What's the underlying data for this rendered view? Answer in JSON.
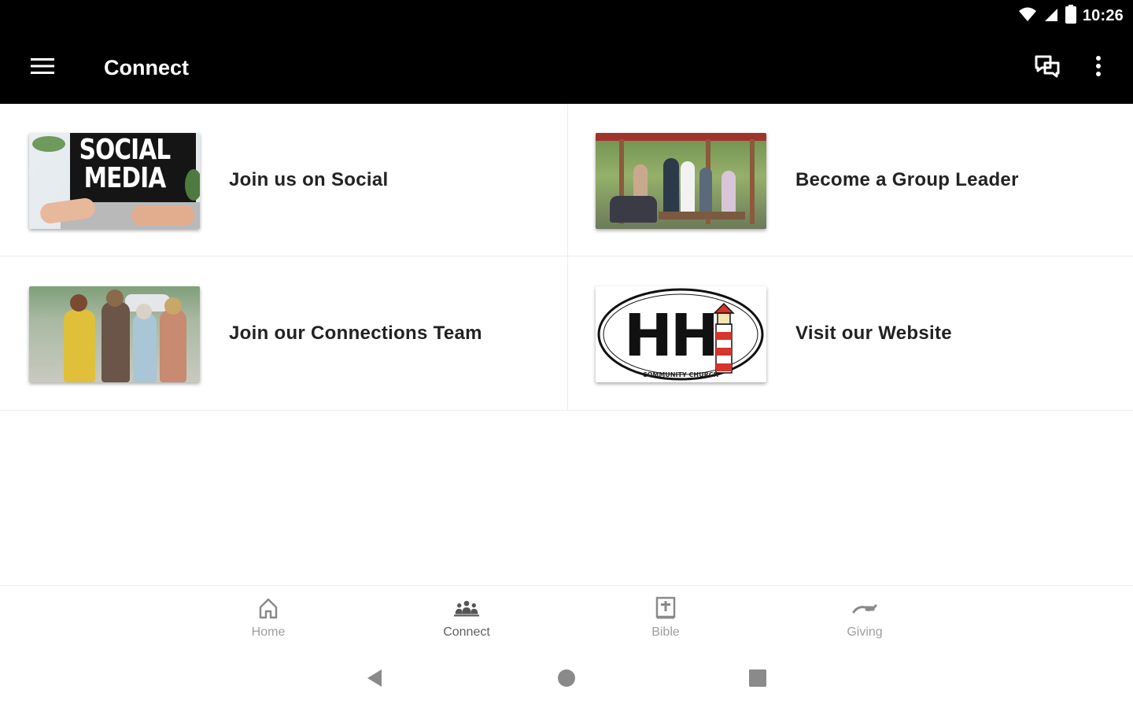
{
  "status_bar": {
    "time": "10:26"
  },
  "app_bar": {
    "title": "Connect"
  },
  "tiles": [
    {
      "label": "Join us on Social",
      "thumb_text": "SOCIAL MEDIA"
    },
    {
      "label": "Become a Group Leader"
    },
    {
      "label": "Join our Connections Team"
    },
    {
      "label": "Visit our Website",
      "logo_text": "HH",
      "logo_ring_text": "COMMUNITY CHURCH"
    }
  ],
  "bottom_nav": {
    "items": [
      {
        "label": "Home",
        "icon": "home-icon"
      },
      {
        "label": "Connect",
        "icon": "people-group-icon",
        "active": true
      },
      {
        "label": "Bible",
        "icon": "bible-icon"
      },
      {
        "label": "Giving",
        "icon": "giving-hand-icon"
      }
    ]
  },
  "system_nav": {
    "back": "back-triangle-icon",
    "home": "home-circle-icon",
    "recents": "recents-square-icon"
  },
  "colors": {
    "app_bar_bg": "#000000",
    "logo_red": "#d6342c",
    "label_text": "#222222"
  }
}
